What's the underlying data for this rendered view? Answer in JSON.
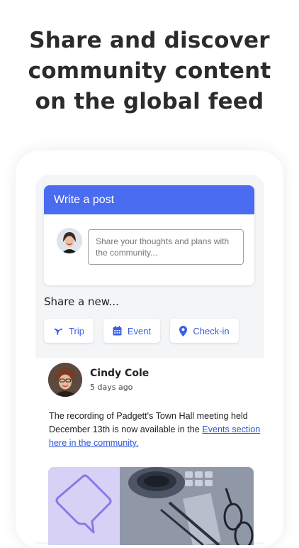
{
  "headline": {
    "line1": "Share and discover",
    "line2": "community content",
    "line3": "on the global feed"
  },
  "write_post": {
    "title": "Write a post",
    "placeholder_line1": "Share your thoughts and plans with",
    "placeholder_line2": "the community..."
  },
  "share": {
    "label": "Share a new...",
    "buttons": [
      {
        "label": "Trip",
        "icon": "airplane-icon"
      },
      {
        "label": "Event",
        "icon": "calendar-icon"
      },
      {
        "label": "Check-in",
        "icon": "map-pin-icon"
      }
    ]
  },
  "post": {
    "author": "Cindy Cole",
    "time": "5 days ago",
    "body_text": "The recording of Padgett's Town Hall meeting held December 13th is now available in the ",
    "link_text": "Events section here in the community."
  },
  "colors": {
    "accent": "#4a6cf0",
    "link": "#2d55d6",
    "media_tint": "#d7d1f5"
  }
}
